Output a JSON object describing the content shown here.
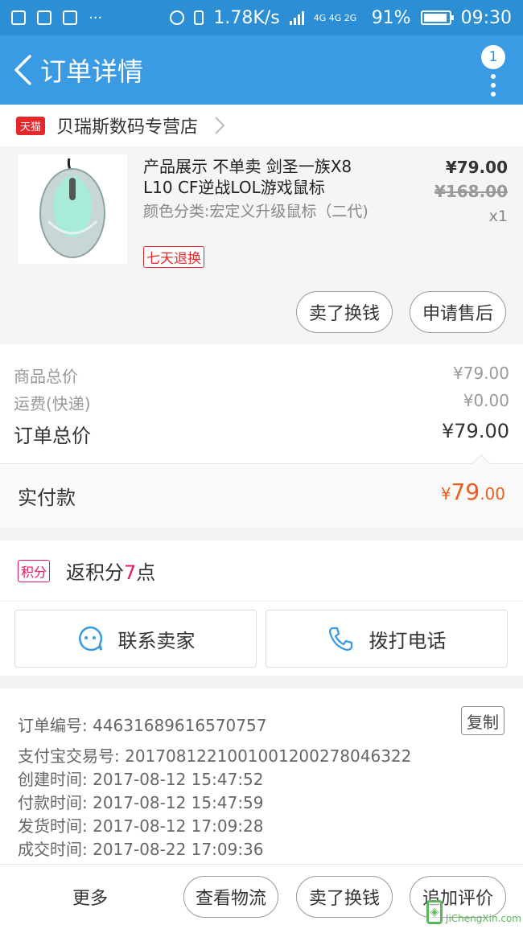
{
  "status_bar": {
    "speed": "1.78K/s",
    "network": "4G 4G 2G",
    "battery": "91%",
    "time": "09:30",
    "more": "···"
  },
  "nav": {
    "title": "订单详情",
    "badge_count": "1"
  },
  "shop": {
    "badge": "天猫",
    "name": "贝瑞斯数码专营店"
  },
  "product": {
    "title": "产品展示 不单卖 剑圣一族X8 L10 CF逆战LOL游戏鼠标",
    "sku": "颜色分类:宏定义升级鼠标（二代)",
    "tag": "七天退换",
    "price": "¥79.00",
    "original_price": "¥168.00",
    "quantity": "x1",
    "btn_sell": "卖了换钱",
    "btn_aftersale": "申请售后"
  },
  "totals": {
    "goods_label": "商品总价",
    "goods_value": "¥79.00",
    "shipping_label": "运费(快递)",
    "shipping_value": "¥0.00",
    "order_label": "订单总价",
    "order_value": "¥79.00",
    "paid_label": "实付款",
    "paid_currency": "¥",
    "paid_int": "79",
    "paid_dec": ".00"
  },
  "points": {
    "tag": "积分",
    "prefix": "返积分",
    "number": "7",
    "suffix": "点"
  },
  "contact": {
    "seller": "联系卖家",
    "phone": "拨打电话"
  },
  "order_info": {
    "copy_label": "复制",
    "rows": [
      "订单编号: 44631689616570757",
      "支付宝交易号: 2017081221001001200278046322",
      "创建时间: 2017-08-12 15:47:52",
      "付款时间: 2017-08-12 15:47:59",
      "发货时间: 2017-08-12 17:09:28",
      "成交时间: 2017-08-22 17:09:36"
    ]
  },
  "bottom": {
    "more": "更多",
    "logistics": "查看物流",
    "sell": "卖了换钱",
    "review": "追加评价"
  },
  "watermark": {
    "text": "JiChengXin.com"
  },
  "colors": {
    "nav_blue": "#3a9be4",
    "status_blue": "#2c8fd6",
    "tmall_red": "#e6272b",
    "paid_orange": "#f05a1a",
    "points_pink": "#e6195c"
  }
}
